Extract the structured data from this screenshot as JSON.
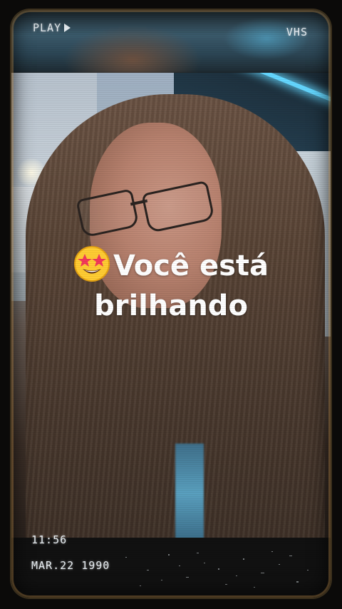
{
  "overlay": {
    "play_label": "PLAY",
    "format_label": "VHS",
    "time": "11:56",
    "date": "MAR.22 1990"
  },
  "caption": {
    "emoji_icon": "star-struck-emoji",
    "line1": "Você está",
    "line2": "brilhando"
  },
  "colors": {
    "caption_text": "#ffffff",
    "osd_text": "#e8eef2",
    "neon_accent": "#64d7ff",
    "frame_border": "#c89650"
  }
}
